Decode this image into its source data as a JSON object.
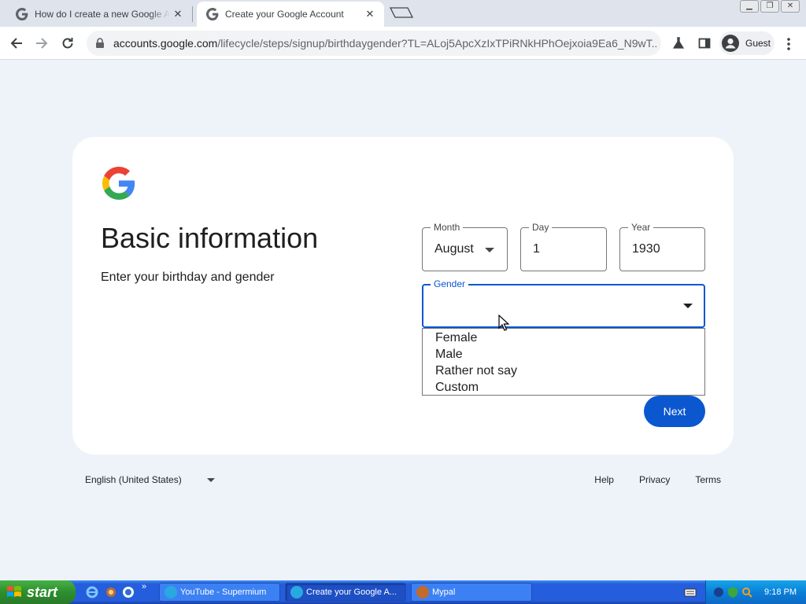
{
  "browser": {
    "tabs": [
      {
        "title": "How do I create a new Google Account",
        "active": false
      },
      {
        "title": "Create your Google Account",
        "active": true
      }
    ],
    "address": {
      "host": "accounts.google.com",
      "path": "/lifecycle/steps/signup/birthdaygender?TL=ALoj5ApcXzIxTPiRNkHPhOejxoia9Ea6_N9wT..."
    },
    "profile_name": "Guest"
  },
  "page": {
    "heading": "Basic information",
    "subheading": "Enter your birthday and gender",
    "month": {
      "label": "Month",
      "value": "August"
    },
    "day": {
      "label": "Day",
      "value": "1"
    },
    "year": {
      "label": "Year",
      "value": "1930"
    },
    "gender": {
      "label": "Gender",
      "value": "",
      "options": [
        "Female",
        "Male",
        "Rather not say",
        "Custom"
      ]
    },
    "next_label": "Next"
  },
  "footer": {
    "language": "English (United States)",
    "links": [
      "Help",
      "Privacy",
      "Terms"
    ]
  },
  "taskbar": {
    "start_label": "start",
    "tasks": [
      {
        "title": "YouTube - Supermium",
        "active": false
      },
      {
        "title": "Create your Google A...",
        "active": true
      },
      {
        "title": "Mypal",
        "active": false
      }
    ],
    "clock": "9:18 PM"
  },
  "colors": {
    "accent": "#0b57d0",
    "page_bg": "#eef2f9"
  }
}
